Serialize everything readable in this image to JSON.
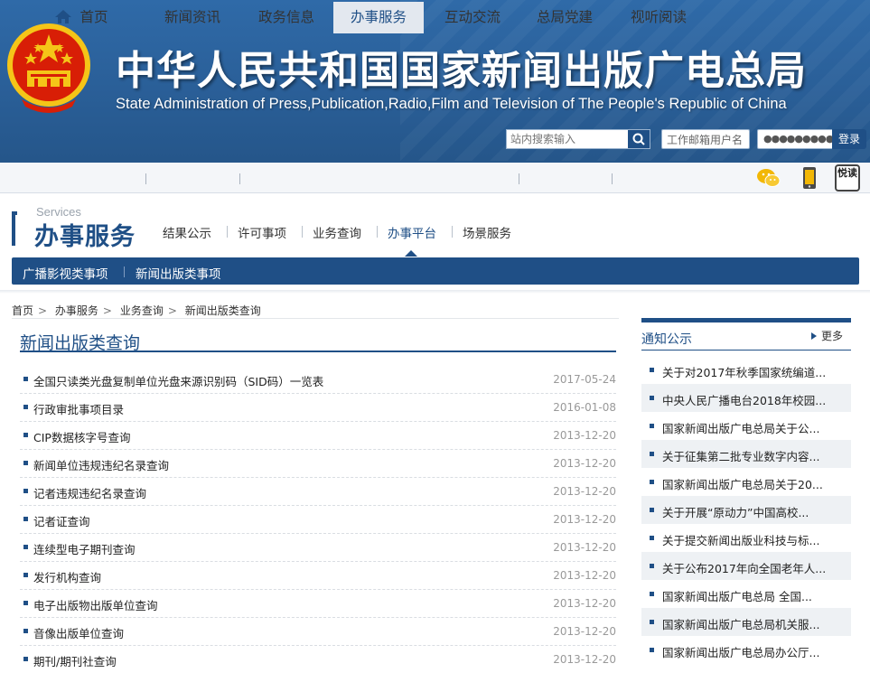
{
  "header": {
    "title": "中华人民共和国国家新闻出版广电总局",
    "subtitle": "State Administration of Press,Publication,Radio,Film and Television of The People's Republic of China",
    "search_placeholder": "站内搜索输入",
    "mail_user_placeholder": "工作邮箱用户名",
    "mail_password_mask": "●●●●●●●●●",
    "login_label": "登录"
  },
  "nav": {
    "items": [
      {
        "label": "首页"
      },
      {
        "label": "新闻资讯"
      },
      {
        "label": "政务信息"
      },
      {
        "label": "办事服务"
      },
      {
        "label": "互动交流"
      },
      {
        "label": "总局党建"
      },
      {
        "label": "视听阅读"
      }
    ],
    "active_index": 3,
    "reader_icon_text": "悦读"
  },
  "section": {
    "en": "Services",
    "cn": "办事服务",
    "subnav": [
      "结果公示",
      "许可事项",
      "业务查询",
      "办事平台",
      "场景服务"
    ],
    "active_sub": 3,
    "categories": [
      "广播影视类事项",
      "新闻出版类事项"
    ]
  },
  "breadcrumb": [
    "首页",
    "办事服务",
    "业务查询",
    "新闻出版类查询"
  ],
  "main": {
    "title": "新闻出版类查询",
    "items": [
      {
        "title": "全国只读类光盘复制单位光盘来源识别码（SID码）一览表",
        "date": "2017-05-24"
      },
      {
        "title": "行政审批事项目录",
        "date": "2016-01-08"
      },
      {
        "title": "CIP数据核字号查询",
        "date": "2013-12-20"
      },
      {
        "title": "新闻单位违规违纪名录查询",
        "date": "2013-12-20"
      },
      {
        "title": "记者违规违纪名录查询",
        "date": "2013-12-20"
      },
      {
        "title": "记者证查询",
        "date": "2013-12-20"
      },
      {
        "title": "连续型电子期刊查询",
        "date": "2013-12-20"
      },
      {
        "title": "发行机构查询",
        "date": "2013-12-20"
      },
      {
        "title": "电子出版物出版单位查询",
        "date": "2013-12-20"
      },
      {
        "title": "音像出版单位查询",
        "date": "2013-12-20"
      },
      {
        "title": "期刊/期刊社查询",
        "date": "2013-12-20"
      }
    ]
  },
  "sidebar": {
    "title": "通知公示",
    "more": "更多",
    "items": [
      "关于对2017年秋季国家统编道...",
      "中央人民广播电台2018年校园...",
      "国家新闻出版广电总局关于公...",
      "关于征集第二批专业数字内容...",
      "国家新闻出版广电总局关于20...",
      "关于开展“原动力”中国高校...",
      "关于提交新闻出版业科技与标...",
      "关于公布2017年向全国老年人...",
      "国家新闻出版广电总局 全国...",
      "国家新闻出版广电总局机关服...",
      "国家新闻出版广电总局办公厅..."
    ]
  },
  "colors": {
    "brand_blue": "#1f4f86",
    "header_blue": "#2a5f98",
    "emblem_red": "#d81e06",
    "emblem_gold": "#f5c518"
  }
}
